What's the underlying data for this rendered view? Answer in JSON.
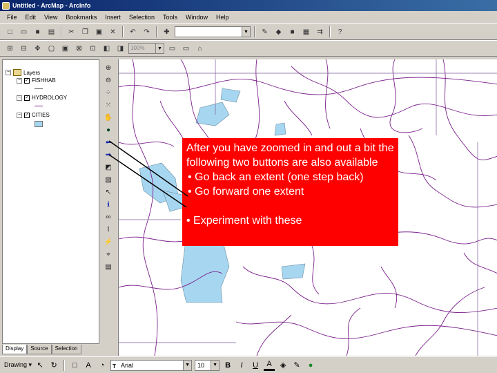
{
  "window": {
    "title": "Untitled - ArcMap - ArcInfo"
  },
  "menu": [
    "File",
    "Edit",
    "View",
    "Bookmarks",
    "Insert",
    "Selection",
    "Tools",
    "Window",
    "Help"
  ],
  "standard_toolbar": {
    "scale_value": ""
  },
  "layout_toolbar": {
    "zoom_level": "100%"
  },
  "toc": {
    "root_label": "Layers",
    "layers": [
      {
        "name": "FISHHAB",
        "checked": true,
        "legend": "line",
        "legend_color": "#606060"
      },
      {
        "name": "HYDROLOGY",
        "checked": true,
        "legend": "line",
        "legend_color": "#7a1f8a"
      },
      {
        "name": "CITIES",
        "checked": true,
        "legend": "polygon",
        "legend_color": "#a7d7f0"
      }
    ],
    "tabs": [
      "Display",
      "Source",
      "Selection"
    ]
  },
  "callout": {
    "intro": "After you have zoomed in and out a bit the following two buttons are also available",
    "bullets": [
      "Go back an extent (one step back)",
      "Go forward one extent"
    ],
    "footer": "• Experiment with these"
  },
  "drawing_toolbar": {
    "drawing_label": "Drawing",
    "font_name": "Arial",
    "font_size": "10"
  },
  "colors": {
    "callout_bg": "#ff0000",
    "stream": "#7a1f8a",
    "water_polygon": "#a7d7f0",
    "titlebar": "#0a246a"
  }
}
